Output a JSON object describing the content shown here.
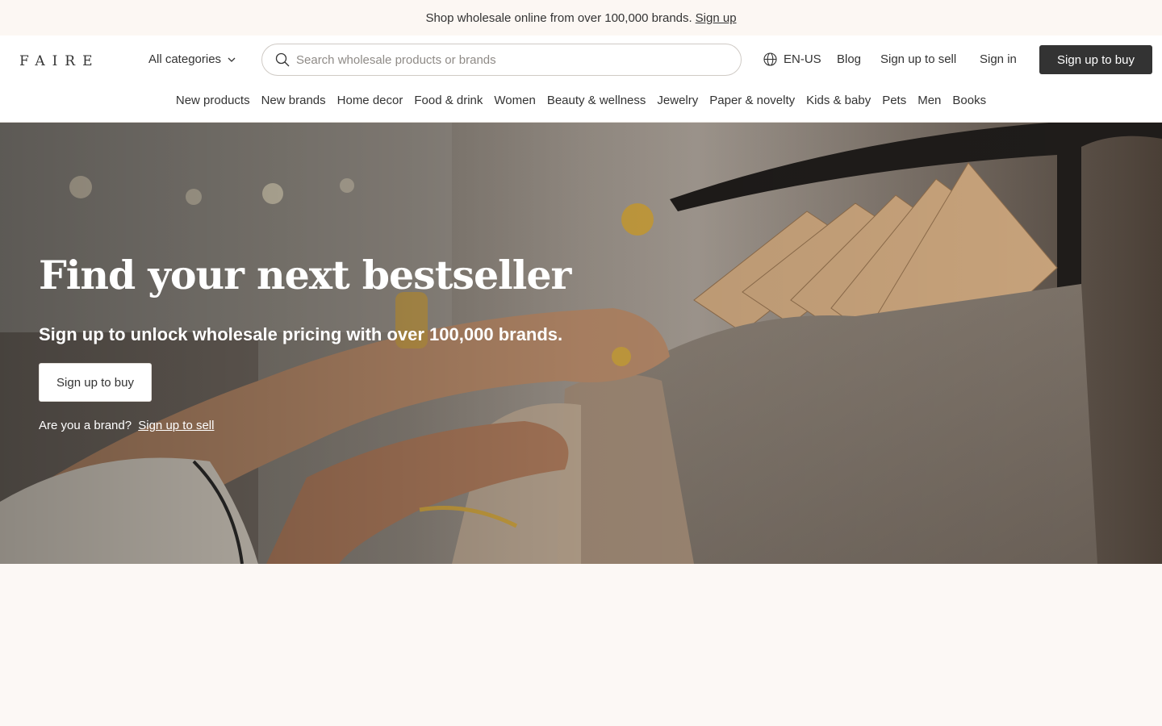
{
  "promo": {
    "text": "Shop wholesale online from over 100,000 brands.",
    "link": "Sign up"
  },
  "header": {
    "logo": "FAIRE",
    "all_categories": "All categories",
    "search_placeholder": "Search wholesale products or brands",
    "language": "EN-US",
    "blog": "Blog",
    "sign_up_to_sell": "Sign up to sell",
    "sign_in": "Sign in",
    "sign_up_to_buy": "Sign up to buy"
  },
  "categories": [
    "New products",
    "New brands",
    "Home decor",
    "Food & drink",
    "Women",
    "Beauty & wellness",
    "Jewelry",
    "Paper & novelty",
    "Kids & baby",
    "Pets",
    "Men",
    "Books"
  ],
  "hero": {
    "title": "Find your next bestseller",
    "subtitle": "Sign up to unlock wholesale pricing with over 100,000 brands.",
    "button": "Sign up to buy",
    "brand_question": "Are you a brand?",
    "brand_link": "Sign up to sell"
  },
  "icons": {
    "search": "search-icon",
    "globe": "globe-icon",
    "chevron": "chevron-down-icon"
  },
  "colors": {
    "dark_button": "#333333",
    "background": "#fcf8f5"
  }
}
